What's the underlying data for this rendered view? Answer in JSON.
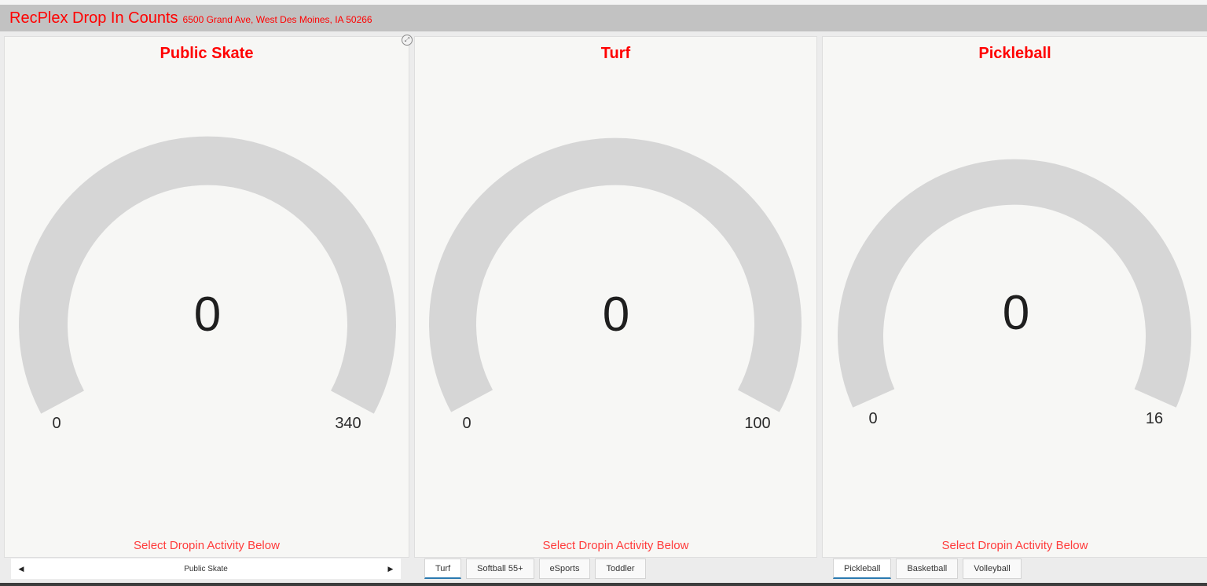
{
  "header": {
    "title": "RecPlex Drop In Counts",
    "subtitle": "6500 Grand Ave, West Des Moines, IA 50266"
  },
  "colors": {
    "accent": "#ff0000",
    "gauge_track": "#d6d6d6",
    "tab_active_underline": "#2a7ab0"
  },
  "gauges": [
    {
      "title": "Public Skate",
      "value": "0",
      "min": "0",
      "max": "340",
      "footer": "Select Dropin Activity Below"
    },
    {
      "title": "Turf",
      "value": "0",
      "min": "0",
      "max": "100",
      "footer": "Select Dropin Activity Below"
    },
    {
      "title": "Pickleball",
      "value": "0",
      "min": "0",
      "max": "16",
      "footer": "Select Dropin Activity Below"
    }
  ],
  "icons": {
    "expand": "expand-icon",
    "prev": "chevron-left-icon",
    "next": "chevron-right-icon"
  },
  "selector": {
    "label": "Public Skate",
    "prev_glyph": "◀",
    "next_glyph": "▶"
  },
  "tabs_turf": [
    "Turf",
    "Softball 55+",
    "eSports",
    "Toddler"
  ],
  "tabs_pickleball": [
    "Pickleball",
    "Basketball",
    "Volleyball"
  ]
}
